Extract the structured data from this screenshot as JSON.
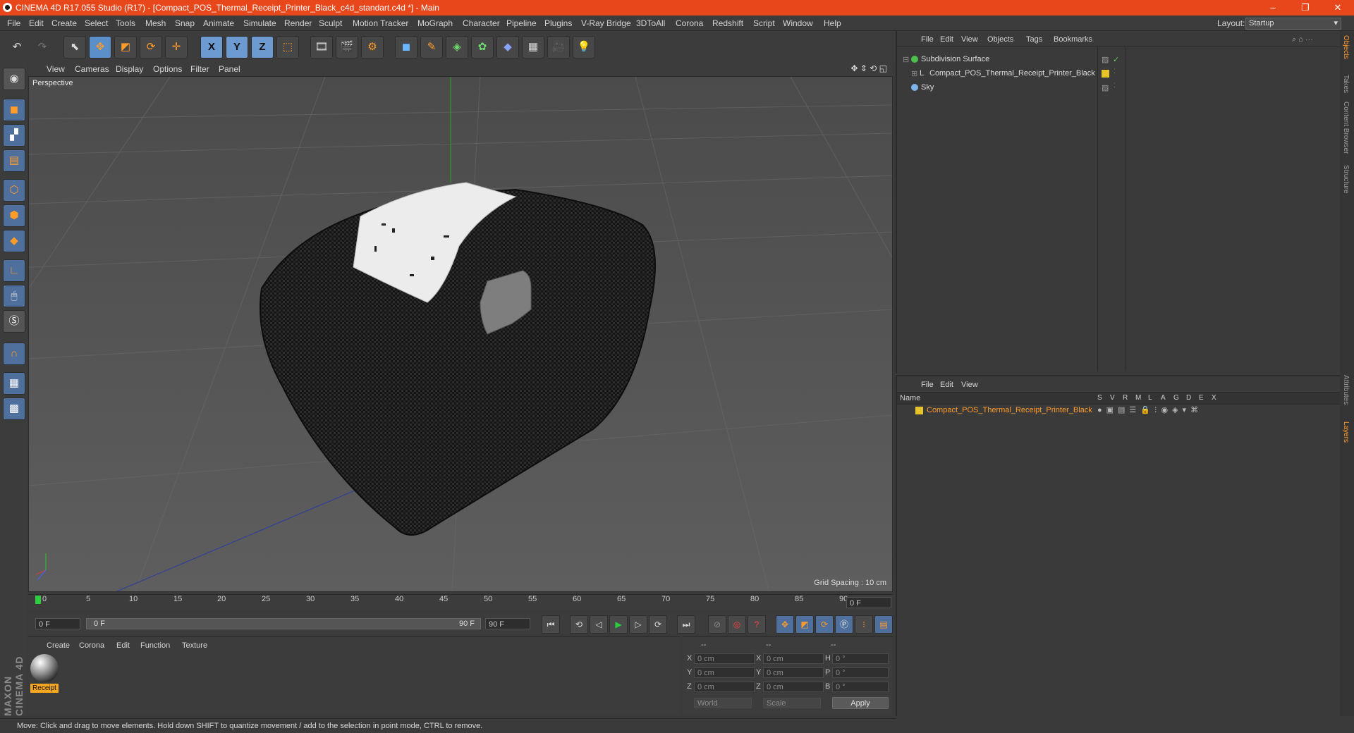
{
  "window": {
    "title": "CINEMA 4D R17.055 Studio (R17) - [Compact_POS_Thermal_Receipt_Printer_Black_c4d_standart.c4d *] - Main",
    "controls": [
      "–",
      "❐",
      "✕"
    ]
  },
  "menubar": {
    "items": [
      "File",
      "Edit",
      "Create",
      "Select",
      "Tools",
      "Mesh",
      "Snap",
      "Animate",
      "Simulate",
      "Render",
      "Sculpt",
      "Motion Tracker",
      "MoGraph",
      "Character",
      "Pipeline",
      "Plugins",
      "V-Ray Bridge",
      "3DToAll",
      "Corona",
      "Redshift",
      "Script",
      "Window",
      "Help"
    ],
    "layout_label": "Layout:",
    "layout_value": "Startup"
  },
  "toolbar": {
    "axis_x": "X",
    "axis_y": "Y",
    "axis_z": "Z"
  },
  "viewport": {
    "menu": [
      "View",
      "Cameras",
      "Display",
      "Options",
      "Filter",
      "Panel"
    ],
    "label": "Perspective",
    "grid_spacing": "Grid Spacing : 10 cm"
  },
  "timeline": {
    "ticks": [
      "0",
      "5",
      "10",
      "15",
      "20",
      "25",
      "30",
      "35",
      "40",
      "45",
      "50",
      "55",
      "60",
      "65",
      "70",
      "75",
      "80",
      "85",
      "90"
    ],
    "current_frame": "0 F",
    "start_field": "0 F",
    "range_start": "0 F",
    "range_end": "90 F",
    "end_field": "90 F"
  },
  "material_panel": {
    "menu": [
      "Create",
      "Corona",
      "Edit",
      "Function",
      "Texture"
    ],
    "material_name": "Receipt"
  },
  "coord_panel": {
    "headers": [
      "--",
      "--",
      "--"
    ],
    "rows": [
      {
        "a": "X",
        "av": "0 cm",
        "b": "X",
        "bv": "0 cm",
        "c": "H",
        "cv": "0 °"
      },
      {
        "a": "Y",
        "av": "0 cm",
        "b": "Y",
        "bv": "0 cm",
        "c": "P",
        "cv": "0 °"
      },
      {
        "a": "Z",
        "av": "0 cm",
        "b": "Z",
        "bv": "0 cm",
        "c": "B",
        "cv": "0 °"
      }
    ],
    "world": "World",
    "scale": "Scale",
    "apply": "Apply"
  },
  "objects_panel": {
    "menu": [
      "File",
      "Edit",
      "View",
      "Objects",
      "Tags",
      "Bookmarks"
    ],
    "items": [
      {
        "name": "Subdivision Surface",
        "indent": 0
      },
      {
        "name": "Compact_POS_Thermal_Receipt_Printer_Black",
        "indent": 1
      },
      {
        "name": "Sky",
        "indent": 0
      }
    ]
  },
  "layers_panel": {
    "menu": [
      "File",
      "Edit",
      "View"
    ],
    "header_name": "Name",
    "flags": [
      "S",
      "V",
      "R",
      "M",
      "L",
      "A",
      "G",
      "D",
      "E",
      "X"
    ],
    "layer_name": "Compact_POS_Thermal_Receipt_Printer_Black"
  },
  "right_tabs": [
    "Objects",
    "Takes",
    "Content Browser",
    "Structure",
    "Attributes",
    "Layers"
  ],
  "status": "Move: Click and drag to move elements. Hold down SHIFT to quantize movement / add to the selection in point mode, CTRL to remove.",
  "brand": "MAXON CINEMA 4D",
  "colors": {
    "titlebar": "#e8471b",
    "accent": "#5b8fc9",
    "orange": "#ff9c2a",
    "layer_yellow": "#e5c42a"
  }
}
